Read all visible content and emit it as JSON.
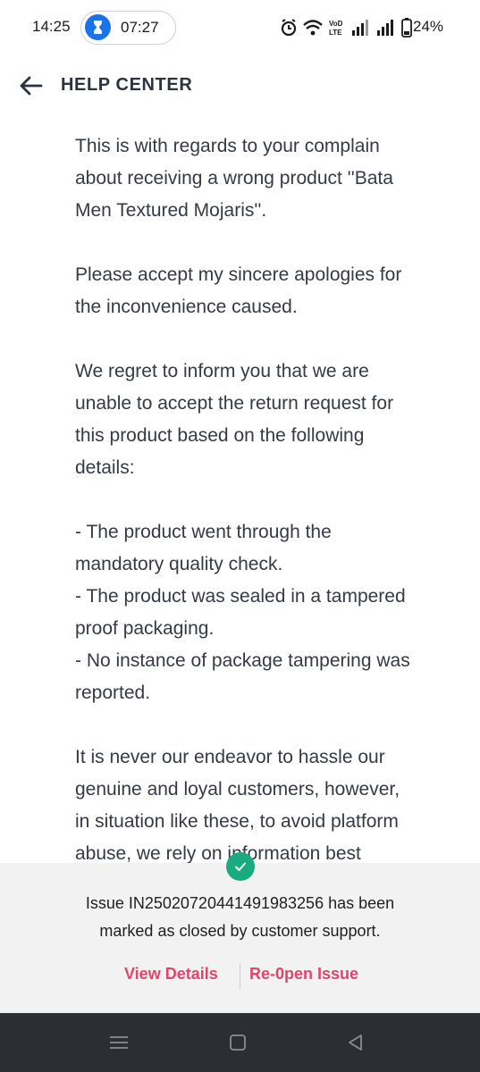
{
  "status_bar": {
    "time": "14:25",
    "timer": "07:27",
    "network_label": "VoD LTE",
    "battery": "24%"
  },
  "header": {
    "title": "HELP CENTER",
    "back_icon": "arrow-left-icon"
  },
  "message": {
    "lines": [
      "This is with regards to your complain",
      "about receiving a wrong product ''Bata",
      "Men Textured Mojaris''.",
      "",
      "Please accept my sincere apologies for",
      "the inconvenience caused.",
      "",
      "We regret to inform you that we are",
      "unable to accept the return request for",
      "this product based on the following",
      "details:",
      "",
      "- The product went through the",
      "mandatory quality check.",
      "- The product was sealed in a tampered",
      "proof packaging.",
      "- No instance of package tampering was",
      "reported.",
      "",
      "It is never our endeavor to hassle our",
      "genuine and loyal customers, however,",
      "in situation like these, to avoid platform",
      "abuse, we rely on information best"
    ]
  },
  "closed_panel": {
    "line1": "Issue IN25020720441491983256 has been",
    "line2": "marked as closed by customer support.",
    "view_details": "View Details",
    "reopen": "Re-0pen Issue",
    "accent_color": "#e0456b",
    "check_color": "#1aaa7f"
  },
  "nav_bar": {
    "icons": [
      "menu-icon",
      "home-square-icon",
      "back-triangle-icon"
    ]
  }
}
